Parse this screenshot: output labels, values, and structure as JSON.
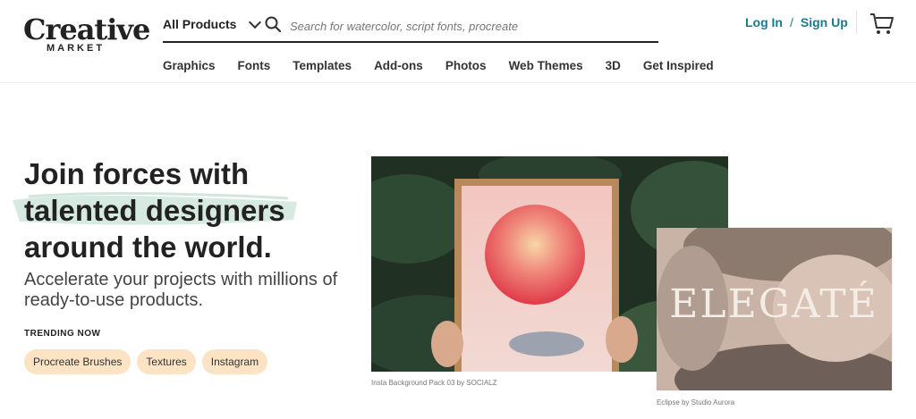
{
  "brand": {
    "logo_script": "Creative",
    "logo_sub": "MARKET"
  },
  "search": {
    "category": "All Products",
    "placeholder": "Search for watercolor, script fonts, procreate",
    "value": ""
  },
  "auth": {
    "login": "Log In",
    "separator": "/",
    "signup": "Sign Up"
  },
  "nav": {
    "items": [
      "Graphics",
      "Fonts",
      "Templates",
      "Add-ons",
      "Photos",
      "Web Themes",
      "3D",
      "Get Inspired"
    ]
  },
  "hero": {
    "title_line1": "Join forces with",
    "title_line2": "talented designers",
    "title_line3": "around the world.",
    "subtitle": "Accelerate your projects with millions of ready-to-use products.",
    "trending_label": "TRENDING NOW",
    "trending": [
      "Procreate Brushes",
      "Textures",
      "Instagram"
    ]
  },
  "images": {
    "main_caption": "Insta Background Pack 03 by SOCIALZ",
    "second_caption": "Eclipse by Studio Aurora",
    "second_overlay_text": "ELEGATÉ"
  },
  "colors": {
    "accent": "#1a7a8a",
    "pill_bg": "#fbe3c4",
    "brush": "#cfe6dd"
  },
  "icons": {
    "search": "search-icon",
    "chevron": "chevron-down-icon",
    "cart": "cart-icon"
  }
}
